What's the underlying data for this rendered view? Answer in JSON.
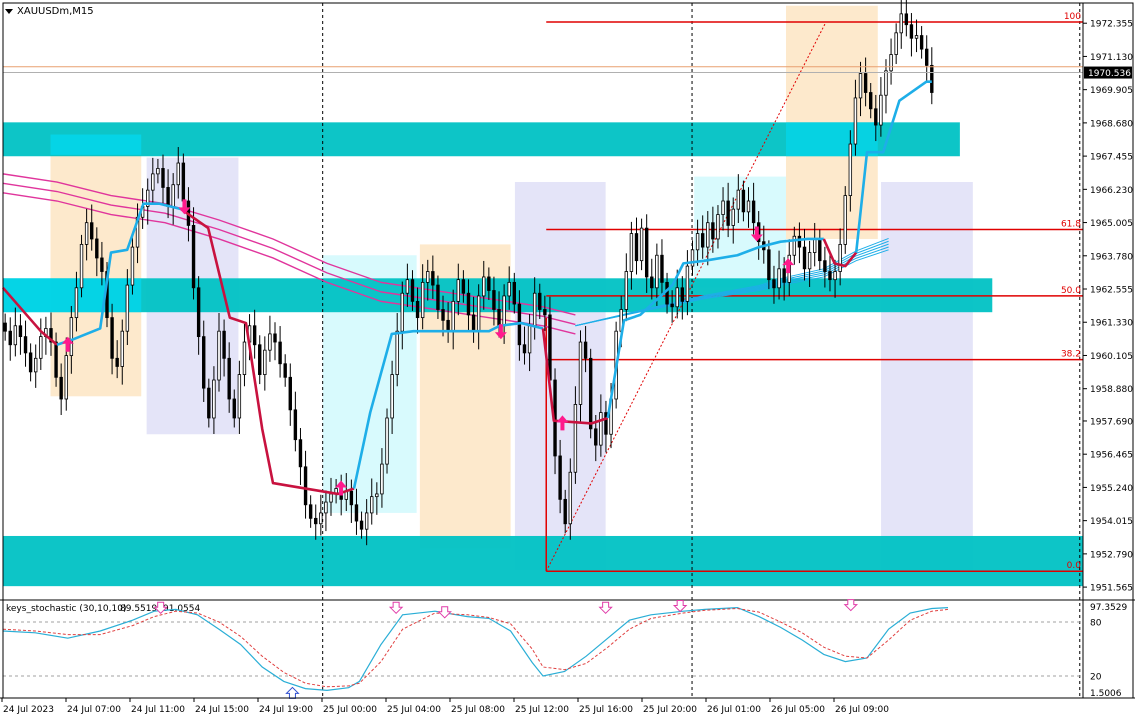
{
  "window": {
    "title": "XAUUSDm,M15",
    "menu_icon": "triangle-down-icon"
  },
  "chart_data": [
    {
      "type": "candlestick",
      "symbol": "XAUUSDm",
      "timeframe": "M15",
      "ylim": [
        1951.2,
        1973.1
      ],
      "price_ticks": [
        "1972.355",
        "1971.130",
        "1969.905",
        "1968.680",
        "1967.455",
        "1966.230",
        "1965.005",
        "1963.780",
        "1962.555",
        "1961.330",
        "1960.105",
        "1958.880",
        "1957.690",
        "1956.465",
        "1955.240",
        "1954.015",
        "1952.790",
        "1951.565"
      ],
      "time_labels": [
        "24 Jul 2023",
        "24 Jul 07:00",
        "24 Jul 11:00",
        "24 Jul 15:00",
        "24 Jul 19:00",
        "25 Jul 00:00",
        "25 Jul 04:00",
        "25 Jul 08:00",
        "25 Jul 12:00",
        "25 Jul 16:00",
        "25 Jul 20:00",
        "26 Jul 01:00",
        "26 Jul 05:00",
        "26 Jul 09:00"
      ],
      "ask_price_label": "1970.536",
      "bid_price": 1970.536,
      "ask_price": 1970.75,
      "colors": {
        "candle": "#000000",
        "zone": "#00c2c4",
        "zone_light": "#00e0ff",
        "trend_up": "#1eaee8",
        "trend_down": "#c8123f",
        "ma_band": "#e0359c",
        "fib": "#e00000",
        "arrow": "#ff1a8c",
        "session_orange": "#fde9cc",
        "session_lavender": "#e4e4f8",
        "session_cyan": "#d8fafd",
        "price_line": "#e8a070"
      },
      "fib_levels": [
        {
          "label": "100",
          "price": 1972.4
        },
        {
          "label": "61.8",
          "price": 1964.75
        },
        {
          "label": "50.0",
          "price": 1962.3
        },
        {
          "label": "38.2",
          "price": 1959.95
        },
        {
          "label": "0.0",
          "price": 1952.15
        }
      ],
      "zones": [
        {
          "y1": 1967.45,
          "y2": 1968.7
        },
        {
          "y1": 1961.7,
          "y2": 1962.95
        },
        {
          "y1": 1951.6,
          "y2": 1953.45
        }
      ],
      "sessions": [
        {
          "color": "orange"
        },
        {
          "color": "lavender"
        },
        {
          "color": "cyan"
        },
        {
          "color": "orange"
        },
        {
          "color": "lavender"
        },
        {
          "color": "cyan"
        },
        {
          "color": "orange"
        },
        {
          "color": "lavender"
        }
      ],
      "signals": [
        {
          "dir": "up",
          "price": 1960.5
        },
        {
          "dir": "down",
          "price": 1965.6
        },
        {
          "dir": "up",
          "price": 1955.2
        },
        {
          "dir": "down",
          "price": 1961.0
        },
        {
          "dir": "up",
          "price": 1957.6
        },
        {
          "dir": "down",
          "price": 1964.6
        },
        {
          "dir": "up",
          "price": 1963.4
        }
      ],
      "trend_line_points": [
        [
          0,
          1962.6
        ],
        [
          0.035,
          1961.0
        ],
        [
          0.05,
          1960.5
        ],
        [
          0.065,
          1960.7
        ],
        [
          0.09,
          1961.1
        ],
        [
          0.1,
          1963.9
        ],
        [
          0.115,
          1964.0
        ],
        [
          0.13,
          1965.7
        ],
        [
          0.145,
          1965.7
        ],
        [
          0.165,
          1965.5
        ],
        [
          0.19,
          1964.8
        ],
        [
          0.21,
          1961.5
        ],
        [
          0.225,
          1961.3
        ],
        [
          0.24,
          1957.4
        ],
        [
          0.25,
          1955.4
        ],
        [
          0.265,
          1955.3
        ],
        [
          0.31,
          1955.0
        ],
        [
          0.325,
          1955.2
        ],
        [
          0.34,
          1958.0
        ],
        [
          0.36,
          1960.9
        ],
        [
          0.38,
          1961.0
        ],
        [
          0.45,
          1961.0
        ],
        [
          0.46,
          1961.2
        ],
        [
          0.48,
          1961.3
        ],
        [
          0.5,
          1961.1
        ],
        [
          0.51,
          1957.7
        ],
        [
          0.545,
          1957.6
        ],
        [
          0.56,
          1957.8
        ],
        [
          0.575,
          1961.4
        ],
        [
          0.59,
          1961.6
        ],
        [
          0.62,
          1962.7
        ],
        [
          0.63,
          1963.5
        ],
        [
          0.65,
          1963.6
        ],
        [
          0.68,
          1963.8
        ],
        [
          0.7,
          1964.1
        ],
        [
          0.72,
          1964.3
        ],
        [
          0.745,
          1964.4
        ],
        [
          0.76,
          1964.4
        ],
        [
          0.77,
          1963.5
        ],
        [
          0.78,
          1963.4
        ],
        [
          0.79,
          1963.9
        ],
        [
          0.8,
          1967.6
        ],
        [
          0.815,
          1967.6
        ],
        [
          0.83,
          1969.5
        ],
        [
          0.855,
          1970.2
        ],
        [
          0.86,
          1970.2
        ]
      ],
      "trend_segments": [
        {
          "from": 0,
          "to": 0.05,
          "color": "down"
        },
        {
          "from": 0.05,
          "to": 0.165,
          "color": "up"
        },
        {
          "from": 0.165,
          "to": 0.325,
          "color": "down"
        },
        {
          "from": 0.325,
          "to": 0.5,
          "color": "up"
        },
        {
          "from": 0.5,
          "to": 0.56,
          "color": "down"
        },
        {
          "from": 0.56,
          "to": 0.76,
          "color": "up"
        },
        {
          "from": 0.76,
          "to": 0.79,
          "color": "down"
        },
        {
          "from": 0.79,
          "to": 0.86,
          "color": "up"
        }
      ],
      "candles_close": [
        1961.0,
        1960.5,
        1961.2,
        1960.8,
        1960.2,
        1959.5,
        1960.0,
        1960.8,
        1961.1,
        1960.6,
        1959.3,
        1958.5,
        1960.1,
        1961.5,
        1962.6,
        1964.2,
        1965.0,
        1964.4,
        1963.7,
        1963.2,
        1961.5,
        1960.0,
        1959.7,
        1961.0,
        1962.7,
        1964.1,
        1965.2,
        1965.6,
        1966.2,
        1966.8,
        1967.0,
        1966.3,
        1965.6,
        1966.4,
        1967.2,
        1965.8,
        1964.9,
        1962.6,
        1960.8,
        1958.9,
        1957.8,
        1959.2,
        1961.0,
        1960.0,
        1958.5,
        1957.8,
        1959.4,
        1960.6,
        1961.2,
        1960.5,
        1959.4,
        1960.3,
        1960.9,
        1960.6,
        1959.8,
        1959.3,
        1958.1,
        1957.0,
        1956.0,
        1954.6,
        1954.1,
        1953.9,
        1954.3,
        1954.7,
        1955.0,
        1955.2,
        1954.8,
        1955.1,
        1954.6,
        1954.0,
        1953.7,
        1954.3,
        1954.9,
        1955.0,
        1956.1,
        1957.8,
        1959.4,
        1961.0,
        1962.4,
        1962.9,
        1962.1,
        1961.5,
        1962.8,
        1963.2,
        1962.7,
        1961.8,
        1961.4,
        1961.0,
        1962.1,
        1962.9,
        1962.4,
        1961.6,
        1961.0,
        1962.3,
        1963.0,
        1962.5,
        1961.8,
        1961.2,
        1962.3,
        1962.8,
        1962.0,
        1960.5,
        1960.2,
        1961.2,
        1962.4,
        1961.8,
        1961.6,
        1959.2,
        1956.4,
        1954.8,
        1953.9,
        1955.8,
        1958.3,
        1960.6,
        1960.0,
        1957.4,
        1956.8,
        1958.0,
        1957.2,
        1958.5,
        1961.0,
        1961.8,
        1963.2,
        1964.6,
        1963.6,
        1964.8,
        1963.0,
        1962.6,
        1963.8,
        1962.8,
        1962.0,
        1961.9,
        1962.6,
        1962.1,
        1963.4,
        1964.0,
        1964.6,
        1964.1,
        1965.0,
        1964.4,
        1965.3,
        1965.8,
        1964.9,
        1965.5,
        1966.2,
        1965.4,
        1965.8,
        1965.0,
        1964.3,
        1964.0,
        1962.9,
        1962.6,
        1963.3,
        1962.8,
        1963.8,
        1964.5,
        1964.1,
        1963.3,
        1963.9,
        1964.4,
        1963.6,
        1963.2,
        1962.9,
        1963.2,
        1964.2,
        1966.0,
        1967.9,
        1969.6,
        1970.5,
        1969.8,
        1969.2,
        1968.6,
        1969.7,
        1970.6,
        1971.2,
        1972.0,
        1972.7,
        1972.3,
        1971.8,
        1971.9,
        1971.4,
        1970.8,
        1969.8
      ],
      "ma_band": [
        [
          0,
          1966.8
        ],
        [
          0.05,
          1966.5
        ],
        [
          0.1,
          1966.0
        ],
        [
          0.15,
          1965.7
        ],
        [
          0.2,
          1965.1
        ],
        [
          0.25,
          1964.4
        ],
        [
          0.3,
          1963.5
        ],
        [
          0.35,
          1962.8
        ],
        [
          0.4,
          1962.5
        ],
        [
          0.45,
          1962.2
        ],
        [
          0.5,
          1961.9
        ],
        [
          0.53,
          1961.6
        ]
      ],
      "fan_lines": [
        [
          0.53,
          1961.2
        ],
        [
          0.6,
          1961.8
        ],
        [
          0.65,
          1962.2
        ],
        [
          0.7,
          1962.5
        ],
        [
          0.72,
          1962.7
        ],
        [
          0.76,
          1963.0
        ],
        [
          0.79,
          1963.6
        ],
        [
          0.82,
          1964.0
        ]
      ],
      "indicator": {
        "name": "keys_stochastic (30,10,10)",
        "value1": "89.5519",
        "value2": "91.0554",
        "ylim": [
          0,
          100
        ],
        "levels": [
          80,
          20
        ],
        "ticks": [
          "97.3529",
          "80",
          "20",
          "1.5006"
        ],
        "main": [
          [
            0,
            70
          ],
          [
            0.03,
            68
          ],
          [
            0.06,
            62
          ],
          [
            0.09,
            70
          ],
          [
            0.12,
            82
          ],
          [
            0.14,
            92
          ],
          [
            0.16,
            94
          ],
          [
            0.18,
            88
          ],
          [
            0.2,
            72
          ],
          [
            0.22,
            55
          ],
          [
            0.24,
            30
          ],
          [
            0.26,
            14
          ],
          [
            0.28,
            6
          ],
          [
            0.3,
            4
          ],
          [
            0.32,
            7
          ],
          [
            0.33,
            14
          ],
          [
            0.35,
            55
          ],
          [
            0.37,
            88
          ],
          [
            0.4,
            92
          ],
          [
            0.43,
            86
          ],
          [
            0.45,
            84
          ],
          [
            0.47,
            70
          ],
          [
            0.49,
            35
          ],
          [
            0.5,
            20
          ],
          [
            0.52,
            25
          ],
          [
            0.54,
            42
          ],
          [
            0.56,
            62
          ],
          [
            0.58,
            82
          ],
          [
            0.6,
            88
          ],
          [
            0.63,
            92
          ],
          [
            0.65,
            94
          ],
          [
            0.68,
            96
          ],
          [
            0.7,
            86
          ],
          [
            0.72,
            74
          ],
          [
            0.74,
            60
          ],
          [
            0.76,
            44
          ],
          [
            0.78,
            36
          ],
          [
            0.8,
            40
          ],
          [
            0.82,
            72
          ],
          [
            0.84,
            90
          ],
          [
            0.86,
            95
          ],
          [
            0.875,
            96
          ]
        ],
        "signal": [
          [
            0,
            72
          ],
          [
            0.03,
            70
          ],
          [
            0.06,
            66
          ],
          [
            0.09,
            66
          ],
          [
            0.12,
            76
          ],
          [
            0.14,
            86
          ],
          [
            0.16,
            92
          ],
          [
            0.18,
            90
          ],
          [
            0.2,
            80
          ],
          [
            0.22,
            64
          ],
          [
            0.24,
            42
          ],
          [
            0.26,
            24
          ],
          [
            0.28,
            12
          ],
          [
            0.3,
            8
          ],
          [
            0.32,
            9
          ],
          [
            0.33,
            12
          ],
          [
            0.35,
            36
          ],
          [
            0.37,
            72
          ],
          [
            0.4,
            90
          ],
          [
            0.43,
            88
          ],
          [
            0.45,
            85
          ],
          [
            0.47,
            78
          ],
          [
            0.49,
            50
          ],
          [
            0.5,
            30
          ],
          [
            0.52,
            27
          ],
          [
            0.54,
            34
          ],
          [
            0.56,
            52
          ],
          [
            0.58,
            72
          ],
          [
            0.6,
            84
          ],
          [
            0.63,
            90
          ],
          [
            0.65,
            93
          ],
          [
            0.68,
            95
          ],
          [
            0.7,
            91
          ],
          [
            0.72,
            80
          ],
          [
            0.74,
            68
          ],
          [
            0.76,
            52
          ],
          [
            0.78,
            42
          ],
          [
            0.8,
            40
          ],
          [
            0.82,
            60
          ],
          [
            0.84,
            82
          ],
          [
            0.86,
            92
          ],
          [
            0.875,
            94
          ]
        ],
        "markers": [
          {
            "dir": "down"
          },
          {
            "dir": "down"
          },
          {
            "dir": "down"
          },
          {
            "dir": "down"
          },
          {
            "dir": "down"
          },
          {
            "dir": "down"
          },
          {
            "dir": "up"
          }
        ]
      }
    }
  ]
}
